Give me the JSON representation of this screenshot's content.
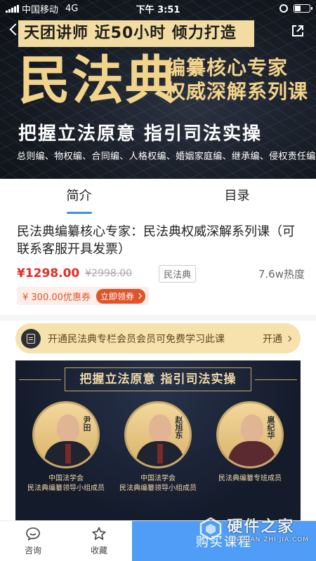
{
  "status_bar": {
    "carrier": "中国移动",
    "network": "4G",
    "time": "下午 3:51"
  },
  "hero": {
    "slogan": "天团讲师  近50小时  倾力打造",
    "main_title": "民法典",
    "sub_line1": "编纂核心专家",
    "sub_line2": "权威深解系列课",
    "tagline": "把握立法原意  指引司法实操",
    "topics": "总则编、物权编、合同编、人格权编、婚姻家庭编、继承编、侵权责任编"
  },
  "tabs": [
    {
      "label": "简介",
      "active": true
    },
    {
      "label": "目录",
      "active": false
    }
  ],
  "course": {
    "title": "民法典编纂核心专家：民法典权威深解系列课（可联系客服开具发票）",
    "price": "¥1298.00",
    "original_price": "¥2998.00",
    "tag": "民法典",
    "heat": "7.6w热度"
  },
  "coupon": {
    "amount": "¥ 300.00优惠券",
    "claim_label": "立即领券"
  },
  "member": {
    "text": "开通民法典专栏会员会员可免费学习此课",
    "action": "开通"
  },
  "poster": {
    "banner": "把握立法原意  指引司法实操",
    "experts": [
      {
        "name": "尹田",
        "desc_line1": "中国法学会",
        "desc_line2": "民法典编纂领导小组成员"
      },
      {
        "name": "赵旭东",
        "desc_line1": "中国法学会",
        "desc_line2": "民法典编纂领导小组成员"
      },
      {
        "name": "扈纪华",
        "desc_line1": "",
        "desc_line2": "民法典编纂专班成员"
      }
    ]
  },
  "bottom_bar": {
    "consult_label": "咨询",
    "favorite_label": "收藏",
    "buy_label": "购买课程"
  },
  "watermark": {
    "text": "硬件之家",
    "sub": "YINGJIAN ZHI JIA.COM"
  },
  "colors": {
    "accent": "#3a8ef6",
    "price": "#e02e24",
    "gold": "#f2d38a",
    "member_bg": "#f7e2ad",
    "buy_button": "#4f9df6"
  }
}
